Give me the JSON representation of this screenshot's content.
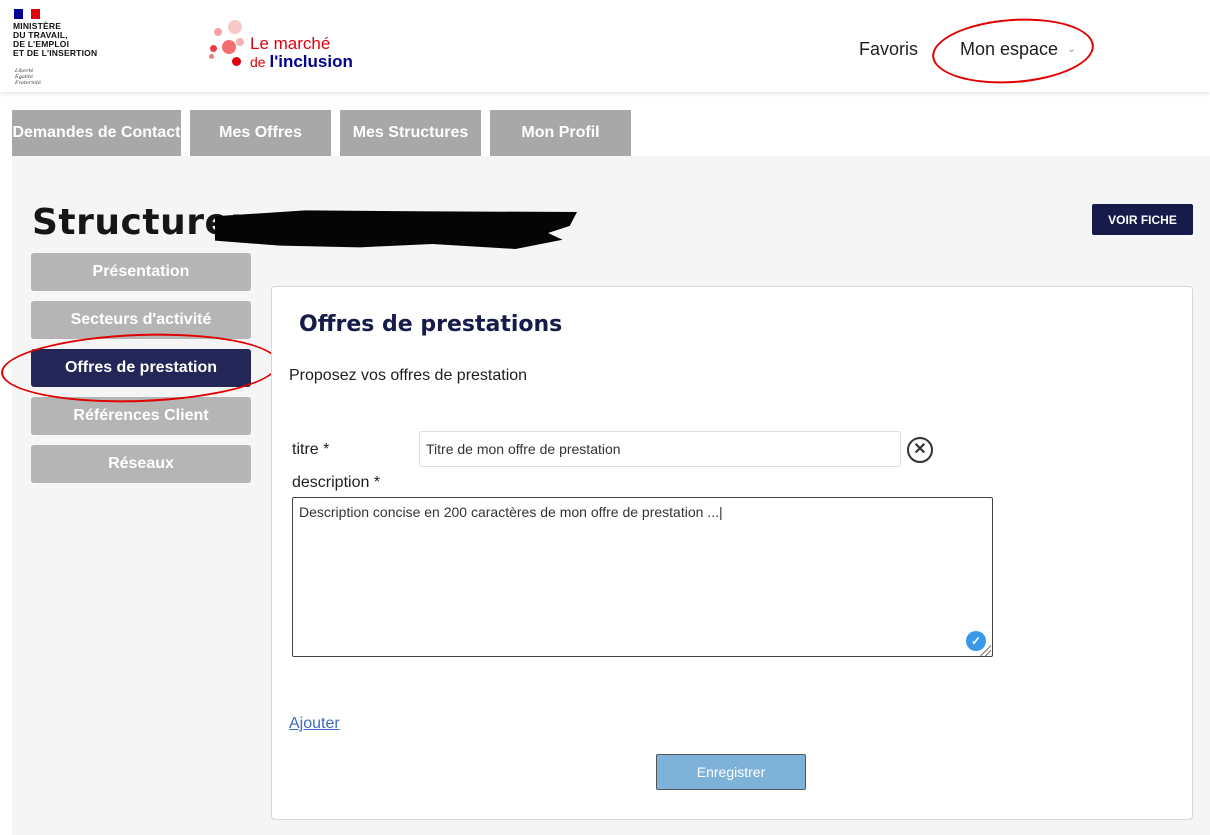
{
  "header": {
    "ministere": "MINISTÈRE\nDU TRAVAIL,\nDE L'EMPLOI\nET DE L'INSERTION",
    "devise": "Liberté\nÉgalité\nFraternité",
    "brand_line1": "Le marché",
    "brand_line2_prefix": "de ",
    "brand_line2_bold": "l'inclusion",
    "nav_favoris": "Favoris",
    "nav_mon_espace": "Mon espace",
    "flag_colors": [
      "#000091",
      "#ffffff",
      "#e1000f"
    ]
  },
  "tabs": [
    {
      "label": "Demandes de Contact"
    },
    {
      "label": "Mes Offres"
    },
    {
      "label": "Mes Structures"
    },
    {
      "label": "Mon Profil"
    }
  ],
  "structure": {
    "title": "Structure:",
    "voir_fiche": "VOIR FICHE"
  },
  "sidebar": {
    "items": [
      {
        "label": "Présentation",
        "active": false
      },
      {
        "label": "Secteurs d'activité",
        "active": false
      },
      {
        "label": "Offres de prestation",
        "active": true
      },
      {
        "label": "Références Client",
        "active": false
      },
      {
        "label": "Réseaux",
        "active": false
      }
    ]
  },
  "form": {
    "title": "Offres de prestations",
    "subtitle": "Proposez vos offres de prestation",
    "titre_label": "titre *",
    "titre_value": "Titre de mon offre de prestation",
    "description_label": "description *",
    "description_value": "Description concise en 200 caractères de mon offre de prestation ...|",
    "ajouter": "Ajouter",
    "enregistrer": "Enregistrer"
  },
  "colors": {
    "active_sidebar": "#232656",
    "inactive_tab": "#a8a8a8",
    "voir_fiche_bg": "#161b4a",
    "save_button": "#7fb2d9",
    "annotation_red": "#e00000"
  }
}
